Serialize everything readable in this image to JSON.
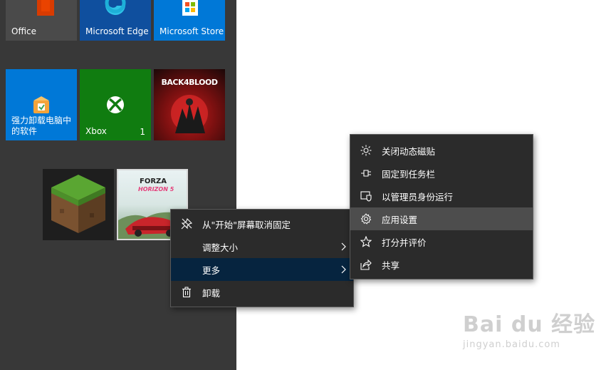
{
  "tiles": {
    "office": {
      "label": "Office"
    },
    "edge": {
      "label": "Microsoft Edge"
    },
    "store": {
      "label": "Microsoft Store"
    },
    "uninstaller": {
      "label": "强力卸载电脑中的软件"
    },
    "xbox": {
      "label": "Xbox",
      "badge": "1"
    },
    "back4blood": {
      "logo_text": "BACK4BLOOD"
    },
    "minecraft": {},
    "forza": {
      "logo_text": "FORZA",
      "logo_sub": "HORIZON 5"
    }
  },
  "context_menu": {
    "items": [
      {
        "label": "从\"开始\"屏幕取消固定",
        "icon": "unpin-icon"
      },
      {
        "label": "调整大小",
        "icon": "",
        "submenu": true
      },
      {
        "label": "更多",
        "icon": "",
        "submenu": true,
        "selected": true
      },
      {
        "label": "卸载",
        "icon": "trash-icon"
      }
    ]
  },
  "submenu": {
    "items": [
      {
        "label": "关闭动态磁贴",
        "icon": "live-tile-off-icon"
      },
      {
        "label": "固定到任务栏",
        "icon": "pin-taskbar-icon"
      },
      {
        "label": "以管理员身份运行",
        "icon": "admin-shield-icon"
      },
      {
        "label": "应用设置",
        "icon": "gear-icon",
        "hover": true
      },
      {
        "label": "打分并评价",
        "icon": "star-icon"
      },
      {
        "label": "共享",
        "icon": "share-icon"
      }
    ]
  },
  "watermark": {
    "main": "Bai du 经验",
    "sub": "jingyan.baidu.com"
  },
  "colors": {
    "edge_tile": "#0f4f9e",
    "store_tile": "#0078d7",
    "uninstaller_tile": "#0078d7",
    "xbox_tile": "#107c10",
    "start_bg": "#383838",
    "menu_bg": "#2b2b2b",
    "menu_selected": "#06243f"
  }
}
